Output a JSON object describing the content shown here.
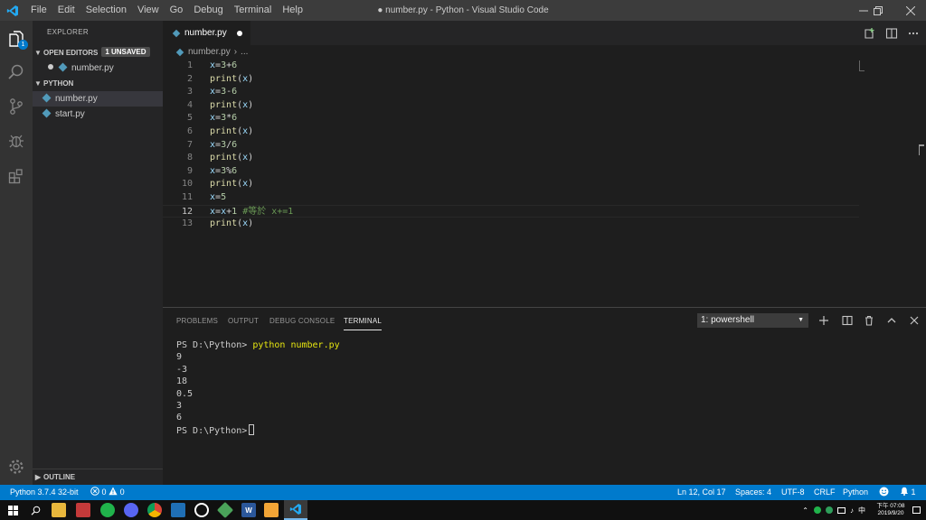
{
  "titlebar": {
    "menu": [
      "File",
      "Edit",
      "Selection",
      "View",
      "Go",
      "Debug",
      "Terminal",
      "Help"
    ],
    "window_title": "● number.py - Python - Visual Studio Code"
  },
  "activity": {
    "explorer_badge": "1"
  },
  "sidebar": {
    "title": "EXPLORER",
    "open_editors_label": "OPEN EDITORS",
    "unsaved_badge": "1 UNSAVED",
    "open_editor_file": "number.py",
    "folder_label": "PYTHON",
    "files": [
      "number.py",
      "start.py"
    ],
    "outline_label": "OUTLINE"
  },
  "editor": {
    "tab_label": "number.py",
    "breadcrumb_file": "number.py",
    "breadcrumb_more": "...",
    "line_numbers": [
      "1",
      "2",
      "3",
      "4",
      "5",
      "6",
      "7",
      "8",
      "9",
      "10",
      "11",
      "12",
      "13"
    ],
    "lines": [
      "x=3+6",
      "print(x)",
      "x=3-6",
      "print(x)",
      "x=3*6",
      "print(x)",
      "x=3/6",
      "print(x)",
      "x=3%6",
      "print(x)",
      "x=5",
      "x=x+1 #等於 x+=1",
      "print(x)"
    ],
    "current_line": 12
  },
  "panel": {
    "tabs": [
      "PROBLEMS",
      "OUTPUT",
      "DEBUG CONSOLE",
      "TERMINAL"
    ],
    "active_tab": "TERMINAL",
    "terminal_select": "1: powershell",
    "prompt": "PS D:\\Python>",
    "command": "python number.py",
    "output": [
      "9",
      "-3",
      "18",
      "0.5",
      "3",
      "6"
    ]
  },
  "statusbar": {
    "interpreter": "Python 3.7.4 32-bit",
    "errors": "0",
    "warnings": "0",
    "position": "Ln 12, Col 17",
    "spaces": "Spaces: 4",
    "encoding": "UTF-8",
    "eol": "CRLF",
    "language": "Python",
    "notifications": "1"
  },
  "taskbar": {
    "ime": "中",
    "clock_time": "下午 07:08",
    "clock_date": "2019/9/20"
  },
  "colors": {
    "accent": "#007acc",
    "title_bar": "#3c3c3c",
    "activity_bar": "#333333",
    "sidebar": "#252526",
    "editor": "#1e1e1e"
  }
}
